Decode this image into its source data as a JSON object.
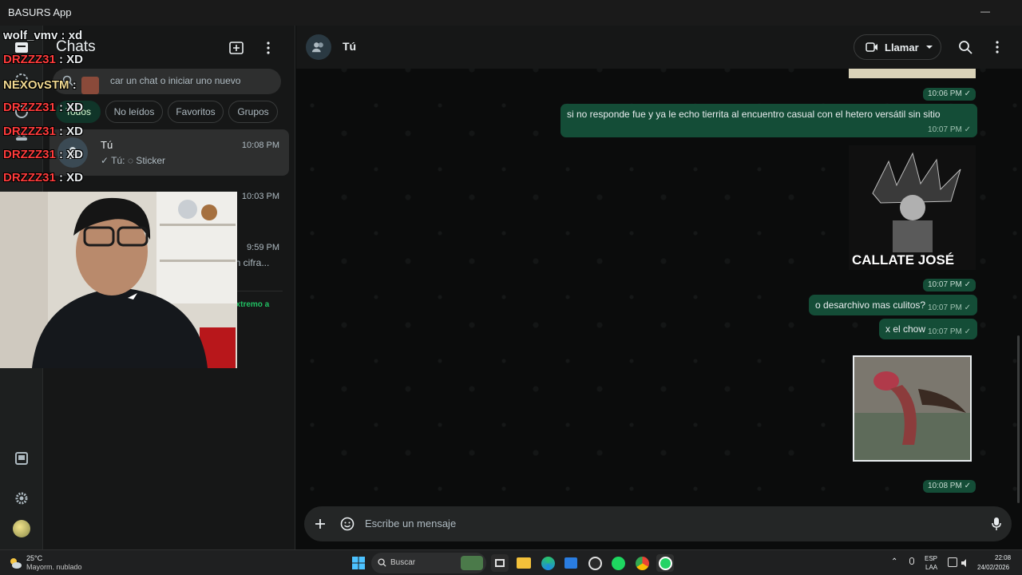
{
  "window": {
    "app_title": "BASURS App",
    "minimize": "—",
    "maximize": "▢",
    "close": "✕"
  },
  "chatlist": {
    "title": "Chats",
    "search_placeholder": "car un chat o iniciar uno nuevo",
    "filters": [
      "Todos",
      "No leídos",
      "Favoritos",
      "Grupos"
    ],
    "chats": [
      {
        "name": "Tú",
        "time": "10:08 PM",
        "preview": "✓ Tú: ◌ Sticker"
      },
      {
        "name": "",
        "time": "10:03 PM",
        "preview": ""
      },
      {
        "name": "",
        "time": "9:59 PM",
        "preview": "án cifra..."
      },
      {
        "name": "",
        "time": "",
        "preview": "extremo a"
      }
    ]
  },
  "conversation": {
    "contact_name": "Tú",
    "call_label": "Llamar",
    "messages": [
      {
        "type": "time",
        "time": "10:06 PM ✓"
      },
      {
        "type": "text",
        "text": "si no responde fue y ya le echo tierrita al encuentro casual con el hetero versátil sin sitio",
        "time": "10:07 PM ✓"
      },
      {
        "type": "sticker",
        "caption": "CALLATE JOSÉ",
        "time": "10:07 PM ✓"
      },
      {
        "type": "text",
        "text": "o desarchivo mas culitos?",
        "time": "10:07 PM ✓"
      },
      {
        "type": "text",
        "text": "x el chow",
        "time": "10:07 PM ✓"
      },
      {
        "type": "photo",
        "time": "10:08 PM ✓"
      }
    ],
    "compose_placeholder": "Escribe un mensaje"
  },
  "stream_chat": [
    {
      "user": "wolf_vmv",
      "msg": ": xd",
      "color": "white"
    },
    {
      "user": "DRZZZ31",
      "msg": ": XD",
      "color": "red"
    },
    {
      "user": "NEXOvSTM",
      "msg": ":",
      "color": "yellow"
    },
    {
      "user": "DRZZZ31",
      "msg": ": XD",
      "color": "red"
    },
    {
      "user": "DRZZZ31",
      "msg": ": XD",
      "color": "red"
    },
    {
      "user": "DRZZZ31",
      "msg": ": XD",
      "color": "red"
    },
    {
      "user": "DRZZZ31",
      "msg": ": XD",
      "color": "red"
    }
  ],
  "taskbar": {
    "weather_temp": "25°C",
    "weather_desc": "Mayorm. nublado",
    "search_label": "Buscar",
    "lang_top": "ESP",
    "lang_bottom": "LAA",
    "clock_time": "22:08",
    "clock_date": "24/02/2026"
  },
  "colors": {
    "bubble": "#144d37",
    "accent": "#21c063",
    "panel": "#161717"
  }
}
